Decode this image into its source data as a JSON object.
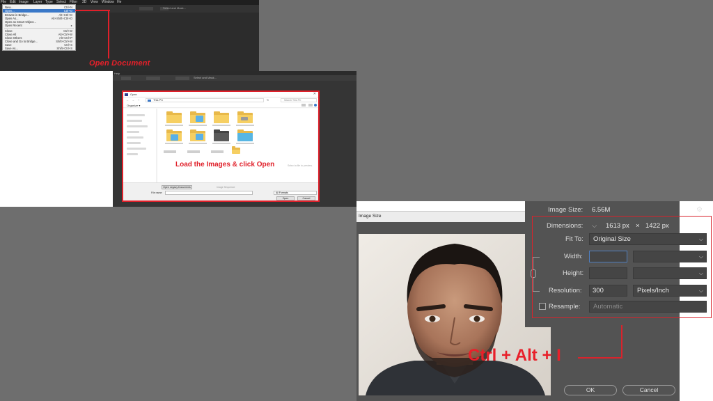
{
  "panel1": {
    "menubar": [
      "File",
      "Edit",
      "Image",
      "Layer",
      "Type",
      "Select",
      "Filter",
      "3D",
      "View",
      "Window",
      "He"
    ],
    "options_label": "Select and Mask...",
    "file_menu": [
      {
        "label": "New...",
        "shortcut": "Ctrl+N"
      },
      {
        "label": "Open...",
        "shortcut": "Ctrl+O",
        "selected": true
      },
      {
        "label": "Browse in Bridge...",
        "shortcut": "Alt+Ctrl+O"
      },
      {
        "label": "Open As...",
        "shortcut": "Alt+Shift+Ctrl+O"
      },
      {
        "label": "Open as Smart Object...",
        "shortcut": ""
      },
      {
        "label": "Open Recent",
        "shortcut": "▸"
      },
      {
        "label": "Close",
        "shortcut": "Ctrl+W"
      },
      {
        "label": "Close All",
        "shortcut": "Alt+Ctrl+W"
      },
      {
        "label": "Close Others",
        "shortcut": "Alt+Ctrl+P"
      },
      {
        "label": "Close and Go to Bridge...",
        "shortcut": "Shift+Ctrl+W"
      },
      {
        "label": "Save",
        "shortcut": "Ctrl+S"
      },
      {
        "label": "Save As...",
        "shortcut": "Shift+Ctrl+S"
      }
    ],
    "annotation": "Open Document"
  },
  "panel2": {
    "menubar_label": "Help",
    "options_label": "Select and Mask...",
    "dialog_title": "Open",
    "address": "This PC",
    "search_placeholder": "Search This PC",
    "organize": "Organize ▾",
    "empty_hint": "Select a file to preview.",
    "open_legacy": "Open Legacy Documents",
    "image_sequence": "Image Sequence",
    "file_name_label": "File name:",
    "format": "All Formats",
    "open_button": "Open",
    "cancel_button": "Cancel",
    "annotation": "Load the Images & click Open"
  },
  "panel3": {
    "title": "Image Size",
    "image_size_label": "Image Size:",
    "image_size_value": "6.56M",
    "dimensions_label": "Dimensions:",
    "dimensions_width": "1613 px",
    "dimensions_x": "×",
    "dimensions_height": "1422 px",
    "fit_to_label": "Fit To:",
    "fit_to_value": "Original Size",
    "width_label": "Width:",
    "height_label": "Height:",
    "resolution_label": "Resolution:",
    "resolution_value": "300",
    "resolution_unit": "Pixels/Inch",
    "resample_label": "Resample:",
    "resample_value": "Automatic",
    "ok_button": "OK",
    "cancel_button": "Cancel",
    "annotation": "Ctrl + Alt + I"
  },
  "colors": {
    "annotation_red": "#e0202a",
    "menu_highlight": "#3a78c8",
    "dialog_dark": "#535353"
  }
}
